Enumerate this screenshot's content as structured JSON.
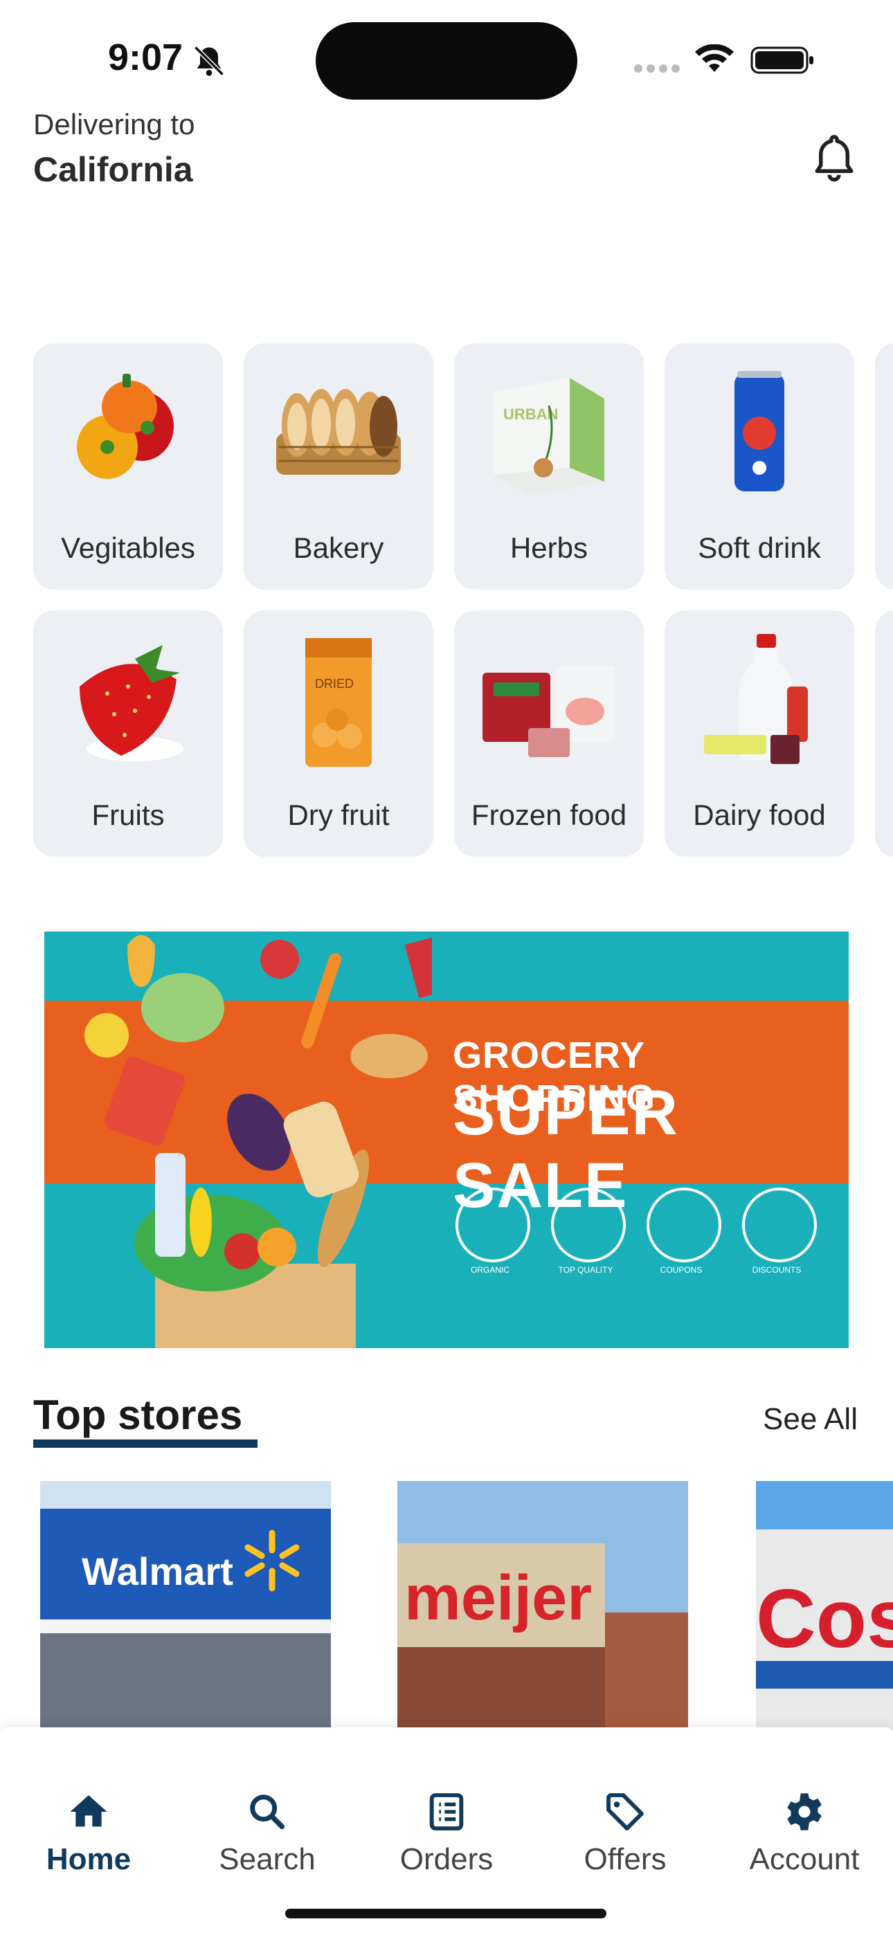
{
  "status_bar": {
    "time": "9:07"
  },
  "header": {
    "delivering_label": "Delivering to",
    "location": "California"
  },
  "categories": [
    {
      "label": "Vegitables",
      "icon": "bell-peppers"
    },
    {
      "label": "Bakery",
      "icon": "bread-basket"
    },
    {
      "label": "Herbs",
      "icon": "herb-kit-box"
    },
    {
      "label": "Soft drink",
      "icon": "soda-can"
    },
    {
      "label": "Fruits",
      "icon": "strawberry"
    },
    {
      "label": "Dry fruit",
      "icon": "dried-apricots"
    },
    {
      "label": "Frozen food",
      "icon": "frozen-packs"
    },
    {
      "label": "Dairy food",
      "icon": "milk-bottle"
    }
  ],
  "banner": {
    "line1": "GROCERY SHOPPING",
    "line2": "SUPER SALE",
    "badges": [
      "ORGANIC",
      "TOP QUALITY",
      "COUPONS",
      "DISCOUNTS"
    ]
  },
  "top_stores": {
    "title": "Top stores",
    "see_all": "See All",
    "stores": [
      {
        "name": "Walmart"
      },
      {
        "name": "meijer"
      },
      {
        "name": "Cos"
      }
    ]
  },
  "nav": {
    "items": [
      {
        "label": "Home",
        "icon": "home-icon",
        "active": true
      },
      {
        "label": "Search",
        "icon": "search-icon",
        "active": false
      },
      {
        "label": "Orders",
        "icon": "orders-icon",
        "active": false
      },
      {
        "label": "Offers",
        "icon": "tag-icon",
        "active": false
      },
      {
        "label": "Account",
        "icon": "gear-icon",
        "active": false
      }
    ]
  },
  "colors": {
    "accent": "#0f3a5e",
    "card_bg": "#eceff3",
    "banner_teal": "#19b0ba",
    "banner_orange": "#e9601e"
  }
}
